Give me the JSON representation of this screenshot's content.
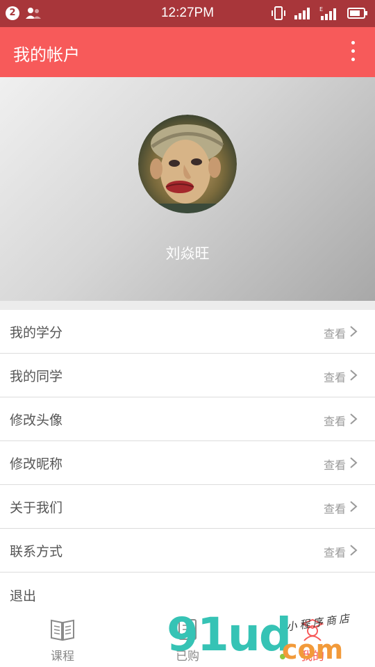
{
  "status_bar": {
    "badge": "2",
    "time": "12:27PM"
  },
  "app_bar": {
    "title": "我的帐户",
    "menu_icon": "more-vert-icon"
  },
  "profile": {
    "username": "刘焱旺"
  },
  "menu": {
    "items": [
      {
        "label": "我的学分",
        "action": "查看"
      },
      {
        "label": "我的同学",
        "action": "查看"
      },
      {
        "label": "修改头像",
        "action": "查看"
      },
      {
        "label": "修改昵称",
        "action": "查看"
      },
      {
        "label": "关于我们",
        "action": "查看"
      },
      {
        "label": "联系方式",
        "action": "查看"
      }
    ],
    "logout": "退出"
  },
  "tabs": [
    {
      "label": "课程",
      "icon": "book-icon"
    },
    {
      "label": "已购",
      "icon": "purchased-icon"
    },
    {
      "label": "我的",
      "icon": "profile-icon",
      "active": true
    }
  ],
  "watermark": {
    "big": "91ud",
    "com": "com",
    "small": "小程序商店"
  },
  "colors": {
    "accent": "#f75a5a",
    "status_bar": "#a8363a"
  }
}
